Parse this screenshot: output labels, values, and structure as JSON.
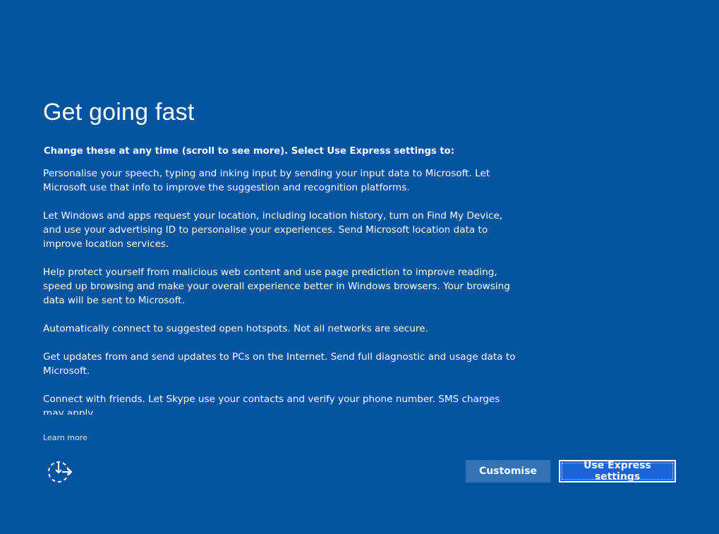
{
  "page": {
    "title": "Get going fast",
    "subtitle": "Change these at any time (scroll to see more). Select Use Express settings to:"
  },
  "paragraphs": [
    "Personalise your speech, typing and inking input by sending your input data to Microsoft. Let Microsoft use that info to improve the suggestion and recognition platforms.",
    "Let Windows and apps request your location, including location history, turn on Find My Device, and use your advertising ID to personalise your experiences. Send Microsoft location data to improve location services.",
    "Help protect yourself from malicious web content and use page prediction to improve reading, speed up browsing and make your overall experience better in Windows browsers. Your browsing data will be sent to Microsoft.",
    "Automatically connect to suggested open hotspots. Not all networks are secure.",
    "Get updates from and send updates to PCs on the Internet. Send full diagnostic and usage data to Microsoft.",
    "Connect with friends. Let Skype use your contacts and verify your phone number. SMS charges may apply."
  ],
  "footer": {
    "learn_more": "Learn more",
    "ease_of_access_icon": "ease-of-access-icon",
    "customise_label": "Customise",
    "express_label": "Use Express settings"
  },
  "colors": {
    "background": "#02549f",
    "customise_button": "#3372b5",
    "express_button": "#1a63d8",
    "text": "#ffffff"
  }
}
